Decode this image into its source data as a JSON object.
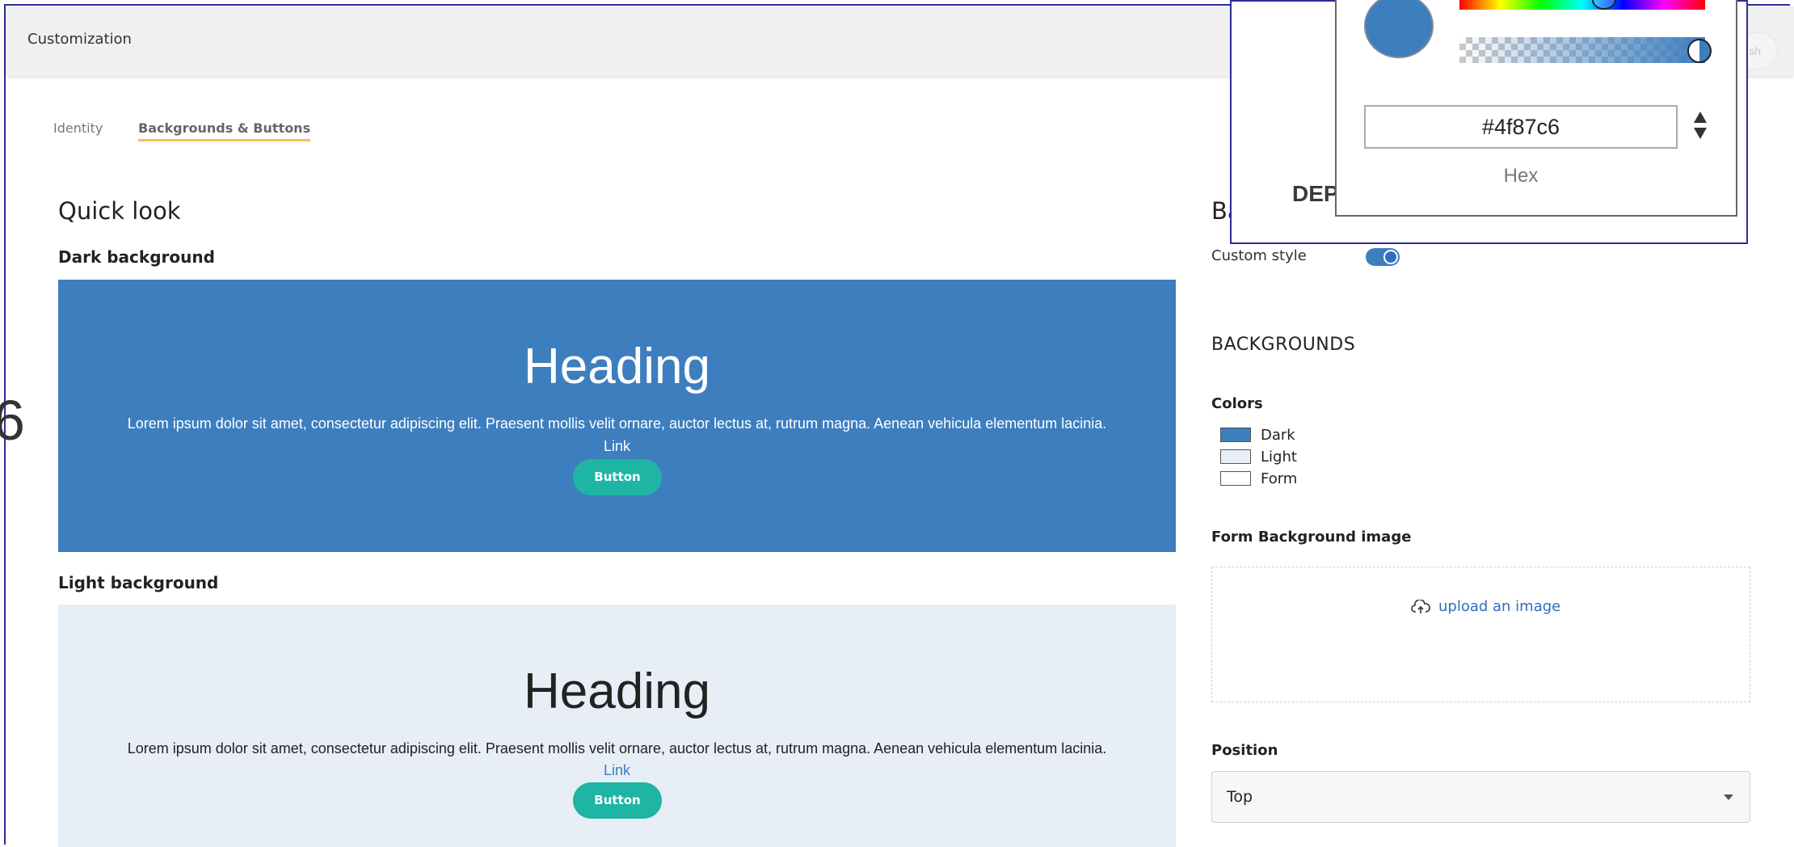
{
  "app": {
    "title": "Customization",
    "publish_partial": "sh",
    "edge_glyph": "6"
  },
  "tabs": [
    {
      "label": "Identity",
      "active": false
    },
    {
      "label": "Backgrounds & Buttons",
      "active": true
    }
  ],
  "quick_look": {
    "title": "Quick look",
    "dark": {
      "label": "Dark background",
      "heading": "Heading",
      "text": "Lorem ipsum dolor sit amet, consectetur adipiscing elit. Praesent mollis velit ornare, auctor lectus at, rutrum magna. Aenean vehicula elementum lacinia.",
      "link": "Link",
      "button": "Button",
      "bg_color": "#3d7ebf"
    },
    "light": {
      "label": "Light background",
      "heading": "Heading",
      "text": "Lorem ipsum dolor sit amet, consectetur adipiscing elit. Praesent mollis velit ornare, auctor lectus at, rutrum magna. Aenean vehicula elementum lacinia.",
      "link": "Link",
      "button": "Button",
      "bg_color": "#e7eef6"
    },
    "button_color": "#1fb5a4"
  },
  "settings": {
    "heading_partial": "Ba",
    "custom_style_label": "Custom style",
    "custom_style_enabled": true,
    "backgrounds_heading": "BACKGROUNDS",
    "colors_label": "Colors",
    "colors": [
      {
        "label": "Dark",
        "swatch": "#3d7ebf"
      },
      {
        "label": "Light",
        "swatch": "#e7eef6"
      },
      {
        "label": "Form",
        "swatch": "#ffffff"
      }
    ],
    "form_bg_label": "Form Background image",
    "upload_link": "upload an image",
    "position_label": "Position",
    "position_value": "Top"
  },
  "color_picker": {
    "hex_value": "#4f87c6",
    "hex_label": "Hex",
    "behind_text": "DEP",
    "selected_color": "#3d7ebf"
  }
}
